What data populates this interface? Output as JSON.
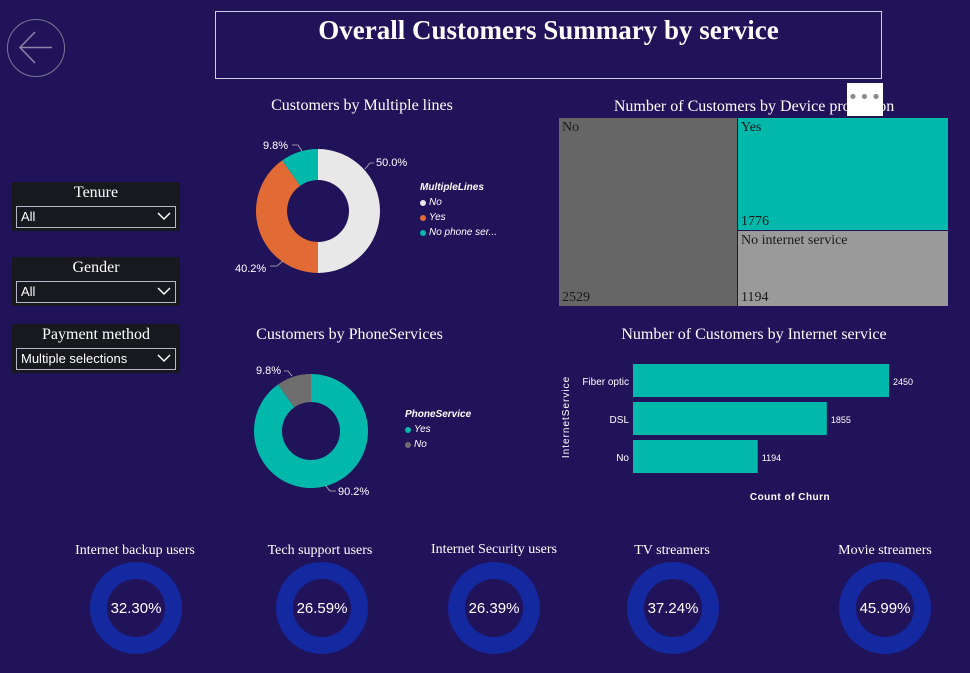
{
  "header": {
    "title": "Overall Customers Summary by service",
    "more_glyph": "•••"
  },
  "slicers": [
    {
      "label": "Tenure",
      "value": "All"
    },
    {
      "label": "Gender",
      "value": "All"
    },
    {
      "label": "Payment method",
      "value": "Multiple selections"
    }
  ],
  "multiple_lines": {
    "title": "Customers by Multiple lines",
    "legend_title": "MultipleLines",
    "legend": [
      "No",
      "Yes",
      "No phone ser..."
    ],
    "slices": [
      {
        "name": "No",
        "pct": 50.0,
        "label": "50.0%",
        "color": "#e8e8e8"
      },
      {
        "name": "Yes",
        "pct": 40.2,
        "label": "40.2%",
        "color": "#e26a35"
      },
      {
        "name": "No phone service",
        "pct": 9.8,
        "label": "9.8%",
        "color": "#01b8aa"
      }
    ]
  },
  "phone_services": {
    "title": "Customers by PhoneServices",
    "legend_title": "PhoneService",
    "legend": [
      "Yes",
      "No"
    ],
    "slices": [
      {
        "name": "Yes",
        "pct": 90.2,
        "label": "90.2%",
        "color": "#01b8aa"
      },
      {
        "name": "No",
        "pct": 9.8,
        "label": "9.8%",
        "color": "#6e6e6e"
      }
    ]
  },
  "device_protection": {
    "title": "Number of Customers by Device protection",
    "cells": [
      {
        "label": "No",
        "value": "2529",
        "color": "#666666"
      },
      {
        "label": "Yes",
        "value": "1776",
        "color": "#01b8aa"
      },
      {
        "label": "No internet service",
        "value": "1194",
        "color": "#9a9a9a"
      }
    ]
  },
  "chart_data": {
    "type": "bar",
    "orientation": "horizontal",
    "title": "Number of Customers by Internet service",
    "ylabel": "InternetService",
    "xlabel": "Count of Churn",
    "categories": [
      "Fiber optic",
      "DSL",
      "No"
    ],
    "values": [
      2450,
      1855,
      1194
    ],
    "color": "#01b8aa"
  },
  "kpis": [
    {
      "label": "Internet backup users",
      "value": "32.30%"
    },
    {
      "label": "Tech support users",
      "value": "26.59%"
    },
    {
      "label": "Internet Security users",
      "value": "26.39%"
    },
    {
      "label": "TV streamers",
      "value": "37.24%"
    },
    {
      "label": "Movie streamers",
      "value": "45.99%"
    }
  ]
}
